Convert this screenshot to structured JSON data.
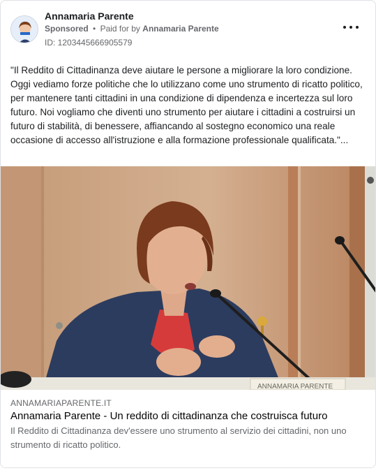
{
  "post": {
    "author": "Annamaria Parente",
    "sponsored_label": "Sponsored",
    "separator": "•",
    "paid_for_prefix": "Paid for by",
    "paid_for_name": "Annamaria Parente",
    "ad_id": "ID: 1203445666905579",
    "body": "\"Il Reddito di Cittadinanza deve aiutare le persone a migliorare la loro condizione. Oggi vediamo forze politiche che lo utilizzano come uno strumento di ricatto politico, per mantenere tanti cittadini in una condizione di dipendenza e incertezza sul loro futuro. Noi vogliamo che diventi uno strumento per aiutare i cittadini a costruirsi un futuro di stabilità, di benessere, affiancando al sostegno economico una reale occasione di accesso all'istruzione e alla formazione professionale qualificata.\"...",
    "image_placard_text": "ANNAMARIA PARENTE"
  },
  "link": {
    "domain": "ANNAMARIAPARENTE.IT",
    "headline": "Annamaria Parente - Un reddito di cittadinanza che costruisca futuro",
    "description": "Il Reddito di Cittadinanza dev'essere uno strumento al servizio dei cittadini, non uno strumento di ricatto politico."
  },
  "icons": {
    "more": "more-options-icon",
    "avatar": "profile-avatar"
  },
  "colors": {
    "text_primary": "#1c1e21",
    "text_secondary": "#65676b",
    "border": "#dfe1e5"
  }
}
